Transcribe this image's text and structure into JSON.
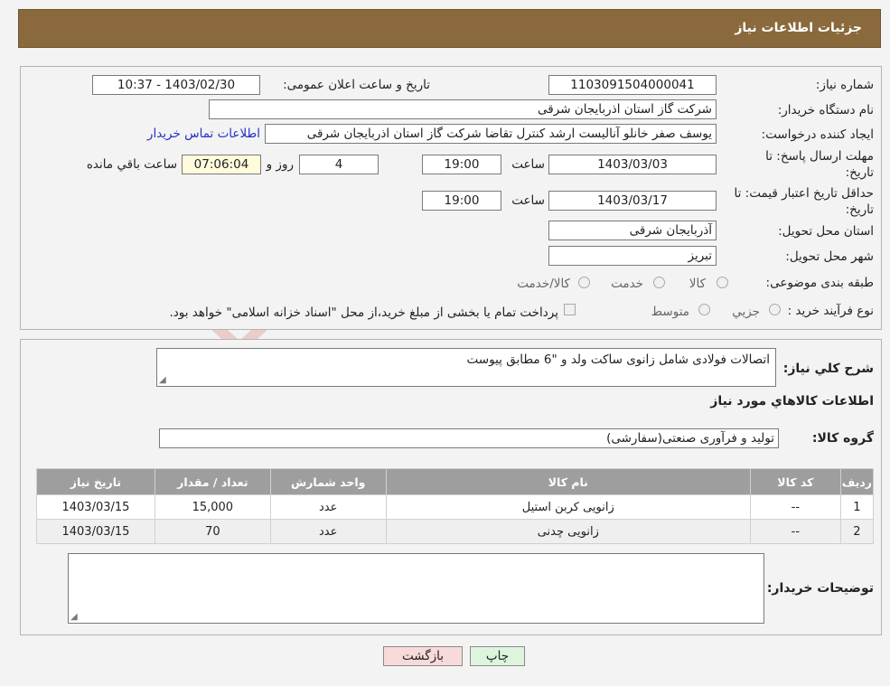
{
  "header": {
    "title": "جزئیات اطلاعات نیاز"
  },
  "form": {
    "need_number_label": "شماره نیاز:",
    "need_number": "1103091504000041",
    "announce_label": "تاریخ و ساعت اعلان عمومی:",
    "announce_value": "1403/02/30 - 10:37",
    "buyer_org_label": "نام دستگاه خریدار:",
    "buyer_org": "شرکت گاز استان اذربایجان شرقی",
    "creator_label": "ایجاد کننده درخواست:",
    "creator": "یوسف صفر خانلو  آنالیست ارشد کنترل تقاضا  شرکت گاز استان اذربایجان شرقی",
    "contact_link": "اطلاعات تماس خریدار",
    "deadline_label_1": "مهلت ارسال پاسخ: تا",
    "deadline_label_2": "تاریخ:",
    "deadline_date": "1403/03/03",
    "time_label": "ساعت",
    "deadline_time": "19:00",
    "days_value": "4",
    "days_label": "روز و",
    "remaining_value": "07:06:04",
    "remaining_label": "ساعت باقي مانده",
    "validity_label_1": "حداقل تاریخ اعتبار قیمت: تا",
    "validity_label_2": "تاریخ:",
    "validity_date": "1403/03/17",
    "validity_time": "19:00",
    "province_label": "استان محل تحویل:",
    "province": "آذربایجان شرقی",
    "city_label": "شهر محل تحویل:",
    "city": "تبریز",
    "category_label": "طبقه بندی موضوعی:",
    "category_options": [
      "کالا",
      "خدمت",
      "کالا/خدمت"
    ],
    "process_label": "نوع فرآیند خرید :",
    "process_options": [
      "جزیي",
      "متوسط"
    ],
    "process_note": "پرداخت تمام یا بخشی از مبلغ خرید،از محل \"اسناد خزانه اسلامی\" خواهد بود."
  },
  "details": {
    "desc_label": "شرح کلي نياز:",
    "desc_value": "اتصالات فولادی شامل زانوی ساکت ولد و \"6 مطابق پیوست",
    "goods_info_title": "اطلاعات کالاهاي مورد نياز",
    "group_label": "گروه کالا:",
    "group_value": "تولید و فرآوری صنعتی(سفارشی)",
    "table": {
      "headers": [
        "رديف",
        "کد کالا",
        "نام کالا",
        "واحد شمارش",
        "تعداد / مقدار",
        "تاريخ نياز"
      ],
      "rows": [
        [
          "1",
          "--",
          "زانویی کربن استیل",
          "عدد",
          "15,000",
          "1403/03/15"
        ],
        [
          "2",
          "--",
          "زانویی چدنی",
          "عدد",
          "70",
          "1403/03/15"
        ]
      ]
    },
    "buyer_notes_label": "توضیحات خریدار:"
  },
  "buttons": {
    "print": "چاپ",
    "back": "بازگشت"
  },
  "watermark_text": "AriaTender.neT",
  "colors": {
    "header": "#8a6a3c",
    "table_header": "#9e9e9e",
    "link": "#2330c9",
    "back_button": "#f9dada",
    "print_button": "#dcf5dc"
  }
}
